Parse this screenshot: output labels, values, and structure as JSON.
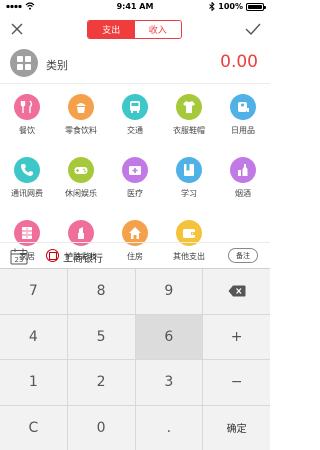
{
  "status_bar": {
    "time": "9:41 AM",
    "battery": "100%"
  },
  "header": {
    "tab_expense": "支出",
    "tab_income": "收入"
  },
  "category": {
    "label": "类别",
    "amount": "0.00"
  },
  "categories": [
    {
      "label": "餐饮",
      "color": "#f06e9a"
    },
    {
      "label": "零食饮料",
      "color": "#f5a04a"
    },
    {
      "label": "交通",
      "color": "#3ec7c9"
    },
    {
      "label": "衣服鞋帽",
      "color": "#a5c93a"
    },
    {
      "label": "日用品",
      "color": "#4fb1e6"
    },
    {
      "label": "通讯网费",
      "color": "#3ec7c9"
    },
    {
      "label": "休闲娱乐",
      "color": "#a5c93a"
    },
    {
      "label": "医疗",
      "color": "#c179e6"
    },
    {
      "label": "学习",
      "color": "#4fb1e6"
    },
    {
      "label": "烟酒",
      "color": "#c179e6"
    },
    {
      "label": "家居",
      "color": "#f06e9a"
    },
    {
      "label": "护肤彩妆",
      "color": "#f06e9a"
    },
    {
      "label": "住房",
      "color": "#f5a04a"
    },
    {
      "label": "其他支出",
      "color": "#f5c33a"
    }
  ],
  "bank": {
    "date_day": "23",
    "name": "工商银行",
    "note_button": "备注"
  },
  "keypad": {
    "k7": "7",
    "k8": "8",
    "k9": "9",
    "k4": "4",
    "k5": "5",
    "k6": "6",
    "plus": "+",
    "k1": "1",
    "k2": "2",
    "k3": "3",
    "minus": "−",
    "clear": "C",
    "k0": "0",
    "dot": ".",
    "confirm": "确定"
  }
}
